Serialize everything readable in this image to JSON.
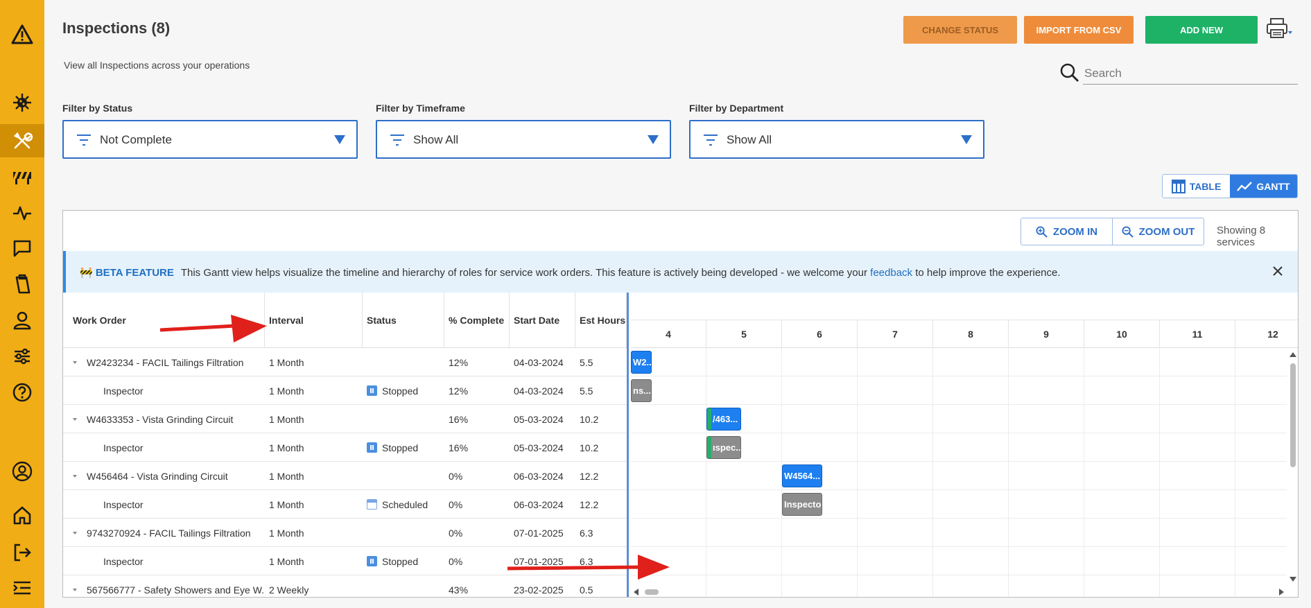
{
  "header": {
    "title": "Inspections (8)",
    "subtitle": "View all Inspections across your operations",
    "change_status": "CHANGE STATUS",
    "import_csv": "IMPORT FROM CSV",
    "add_new": "ADD NEW",
    "search_placeholder": "Search"
  },
  "filters": [
    {
      "label": "Filter by Status",
      "value": "Not Complete"
    },
    {
      "label": "Filter by Timeframe",
      "value": "Show All"
    },
    {
      "label": "Filter by Department",
      "value": "Show All"
    }
  ],
  "view_toggle": {
    "table": "TABLE",
    "gantt": "GANTT",
    "active": "gantt"
  },
  "gantt": {
    "zoom_in": "ZOOM IN",
    "zoom_out": "ZOOM OUT",
    "showing": "Showing 8 services",
    "beta_tag": "🚧 BETA FEATURE",
    "beta_text": "This Gantt view helps visualize the timeline and hierarchy of roles for service work orders. This feature is actively being developed - we welcome your",
    "beta_link": "feedback",
    "beta_tail": "to help improve the experience.",
    "columns": [
      "Work Order",
      "Interval",
      "Status",
      "% Complete",
      "Start Date",
      "Est Hours"
    ],
    "rows": [
      {
        "work_order": "W2423234 - FACIL Tailings Filtration",
        "interval": "1 Month",
        "status": "",
        "complete": "12%",
        "start": "04-03-2024",
        "hours": "5.5",
        "parent": true
      },
      {
        "work_order": "Inspector",
        "interval": "1 Month",
        "status": "Stopped",
        "complete": "12%",
        "start": "04-03-2024",
        "hours": "5.5",
        "parent": false
      },
      {
        "work_order": "W4633353 - Vista Grinding Circuit",
        "interval": "1 Month",
        "status": "",
        "complete": "16%",
        "start": "05-03-2024",
        "hours": "10.2",
        "parent": true
      },
      {
        "work_order": "Inspector",
        "interval": "1 Month",
        "status": "Stopped",
        "complete": "16%",
        "start": "05-03-2024",
        "hours": "10.2",
        "parent": false
      },
      {
        "work_order": "W456464 - Vista Grinding Circuit",
        "interval": "1 Month",
        "status": "",
        "complete": "0%",
        "start": "06-03-2024",
        "hours": "12.2",
        "parent": true
      },
      {
        "work_order": "Inspector",
        "interval": "1 Month",
        "status": "Scheduled",
        "complete": "0%",
        "start": "06-03-2024",
        "hours": "12.2",
        "parent": false
      },
      {
        "work_order": "9743270924 - FACIL Tailings Filtration",
        "interval": "1 Month",
        "status": "",
        "complete": "0%",
        "start": "07-01-2025",
        "hours": "6.3",
        "parent": true
      },
      {
        "work_order": "Inspector",
        "interval": "1 Month",
        "status": "Stopped",
        "complete": "0%",
        "start": "07-01-2025",
        "hours": "6.3",
        "parent": false
      },
      {
        "work_order": "567566777 - Safety Showers and Eye W...",
        "interval": "2 Weekly",
        "status": "",
        "complete": "43%",
        "start": "23-02-2025",
        "hours": "0.5",
        "parent": true
      }
    ],
    "timeline_columns": [
      "4",
      "5",
      "6",
      "7",
      "8",
      "9",
      "10",
      "11",
      "12"
    ],
    "bars": [
      {
        "row": 0,
        "label": "W2...",
        "color": "blue",
        "progress": 0
      },
      {
        "row": 1,
        "label": "ns...",
        "color": "gray",
        "progress": 0
      },
      {
        "row": 2,
        "label": "/463...",
        "color": "blue",
        "progress": 0.16
      },
      {
        "row": 3,
        "label": "ıspec...",
        "color": "gray",
        "progress": 0.16
      },
      {
        "row": 4,
        "label": "W4564...",
        "color": "blue",
        "progress": 0
      },
      {
        "row": 5,
        "label": "Inspector",
        "color": "gray",
        "progress": 0
      }
    ]
  }
}
